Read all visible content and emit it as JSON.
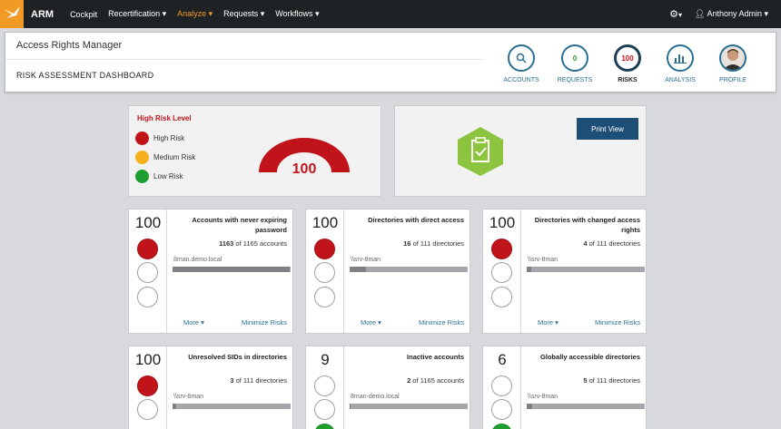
{
  "topnav": {
    "brand": "ARM",
    "items": [
      "Cockpit",
      "Recertification ▾",
      "Analyze ▾",
      "Requests ▾",
      "Workflows ▾"
    ],
    "active_index": 2,
    "settings_caret": "▾",
    "user": "Anthony Admin ▾"
  },
  "header": {
    "app_title": "Access Rights Manager",
    "page_title": "RISK ASSESSMENT DASHBOARD",
    "nav": [
      {
        "label": "ACCOUNTS",
        "icon": "search-icon",
        "value": ""
      },
      {
        "label": "REQUESTS",
        "icon": "",
        "value": "0"
      },
      {
        "label": "RISKS",
        "icon": "",
        "value": "100"
      },
      {
        "label": "ANALYSIS",
        "icon": "bar-chart-icon",
        "value": ""
      },
      {
        "label": "PROFILE",
        "icon": "avatar-icon",
        "value": ""
      }
    ]
  },
  "legend": {
    "title": "High Risk Level",
    "items": [
      {
        "label": "High Risk",
        "color": "#c0141a"
      },
      {
        "label": "Medium Risk",
        "color": "#f5b01c"
      },
      {
        "label": "Low Risk",
        "color": "#1e9e2f"
      }
    ],
    "gauge_value": "100",
    "gauge_fraction": 1.0
  },
  "print_view": "Print View",
  "risk_cards": [
    {
      "score": "100",
      "title": "Accounts with never expiring password",
      "count_bold": "1163",
      "count_rest": " of 1165 accounts",
      "server": "8man.demo.local",
      "level": "high",
      "fill": 0.99
    },
    {
      "score": "100",
      "title": "Directories with direct access",
      "count_bold": "16",
      "count_rest": " of 111 directories",
      "server": "\\\\srv-8man",
      "level": "high",
      "fill": 0.14
    },
    {
      "score": "100",
      "title": "Directories with changed access rights",
      "count_bold": "4",
      "count_rest": " of 111 directories",
      "server": "\\\\srv-8man",
      "level": "high",
      "fill": 0.04
    },
    {
      "score": "100",
      "title": "Unresolved SIDs in directories",
      "count_bold": "3",
      "count_rest": " of 111 directories",
      "server": "\\\\srv-8man",
      "level": "high",
      "fill": 0.03
    },
    {
      "score": "9",
      "title": "Inactive accounts",
      "count_bold": "2",
      "count_rest": " of 1165 accounts",
      "server": "8man-demo.local",
      "level": "low",
      "fill": 0.002
    },
    {
      "score": "6",
      "title": "Globally accessible directories",
      "count_bold": "5",
      "count_rest": " of 111 directories",
      "server": "\\\\srv-8man",
      "level": "low",
      "fill": 0.045
    }
  ],
  "card_links": {
    "more": "More ▾",
    "minimize": "Minimize Risks"
  },
  "colors": {
    "accent": "#f19a25",
    "high": "#c0141a",
    "low": "#1e9e2f",
    "link": "#2a6e94",
    "button": "#1d4f76"
  }
}
